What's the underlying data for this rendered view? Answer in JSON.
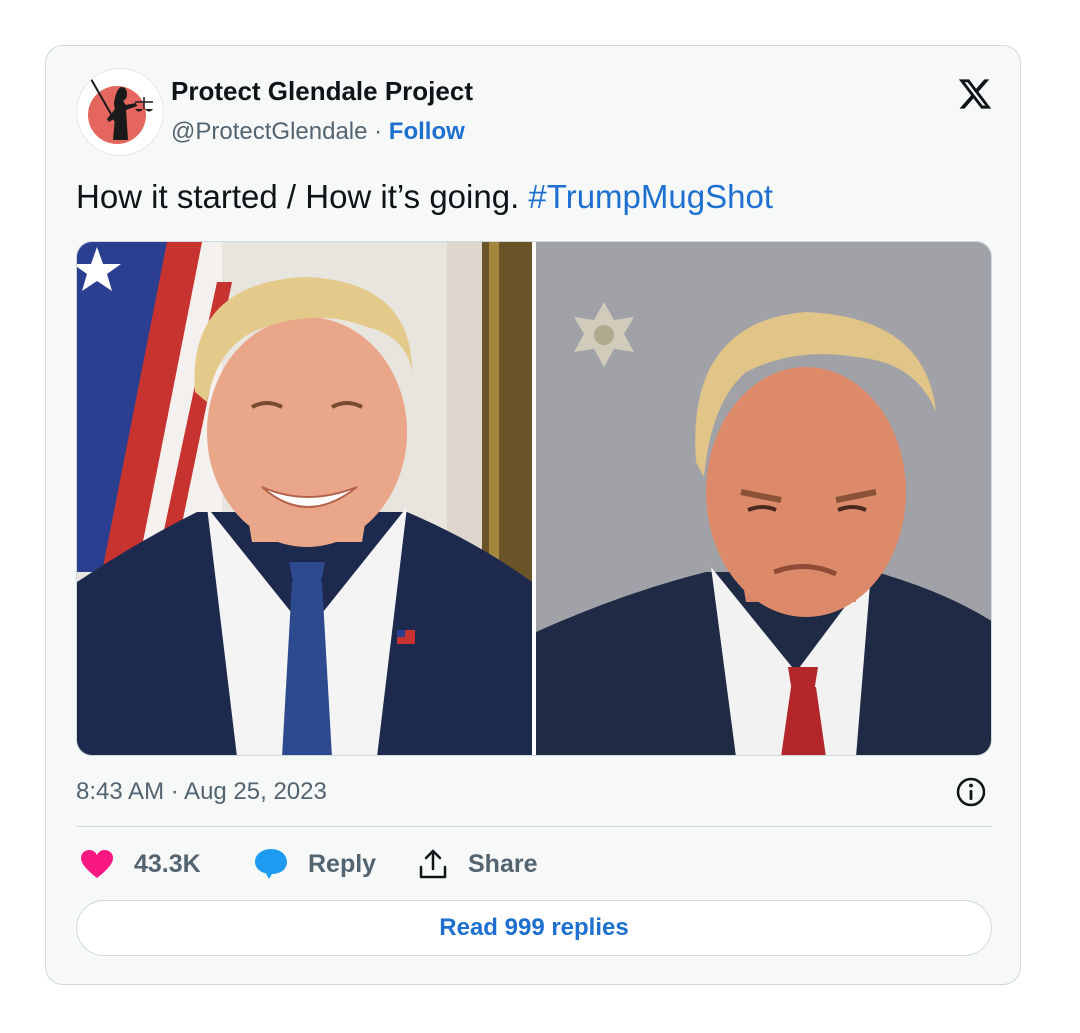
{
  "author": {
    "name": "Protect Glendale Project",
    "handle": "@ProtectGlendale",
    "separator": " · ",
    "follow_label": "Follow"
  },
  "tweet": {
    "text": "How it started / How it’s going. ",
    "hashtag": "#TrumpMugShot"
  },
  "media": [
    {
      "description_icon": "official-portrait-photo"
    },
    {
      "description_icon": "mugshot-photo"
    }
  ],
  "timestamp": "8:43 AM · Aug 25, 2023",
  "actions": {
    "likes_count": "43.3K",
    "reply_label": "Reply",
    "share_label": "Share"
  },
  "read_replies_label": "Read 999 replies",
  "colors": {
    "link_blue": "#1d6fd0",
    "heart_pink": "#f91880",
    "reply_blue": "#1d9bf0",
    "muted_text": "#536471",
    "border": "#cfd9de"
  }
}
